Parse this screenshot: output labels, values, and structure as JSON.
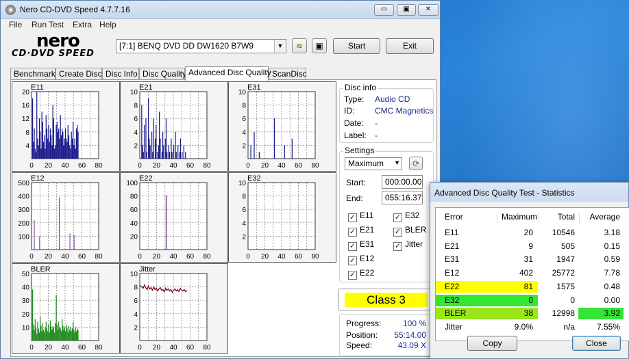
{
  "window": {
    "title": "Nero CD-DVD Speed 4.7.7.16",
    "caption_min": "▭",
    "caption_max": "▣",
    "caption_close": "✕"
  },
  "menu": [
    "File",
    "Run Test",
    "Extra",
    "Help"
  ],
  "logo": {
    "brand": "nero",
    "product": "CD·DVD SPEED"
  },
  "toolbar": {
    "drive": "[7:1]   BENQ DVD DD DW1620 B7W9",
    "start_label": "Start",
    "exit_label": "Exit"
  },
  "tabs": [
    "Benchmark",
    "Create Disc",
    "Disc Info",
    "Disc Quality",
    "Advanced Disc Quality",
    "ScanDisc"
  ],
  "active_tab": "Advanced Disc Quality",
  "charts": [
    {
      "name": "E11",
      "ymax": 20,
      "ticks": [
        "20",
        "16",
        "12",
        "8",
        "4"
      ],
      "color": "#1a1a8c",
      "mode": "bars",
      "values": [
        18,
        5,
        9,
        3,
        2,
        20,
        6,
        4,
        12,
        8,
        3,
        14,
        11,
        5,
        7,
        3,
        13,
        9,
        6,
        10,
        5,
        9,
        7,
        4,
        16,
        12,
        3,
        4,
        10,
        11,
        8,
        9,
        6,
        13,
        7,
        9,
        8,
        4,
        6,
        9,
        6,
        5,
        10,
        7,
        4,
        3,
        8,
        6,
        11,
        4,
        6,
        3,
        9,
        10,
        8
      ]
    },
    {
      "name": "E21",
      "ymax": 10,
      "ticks": [
        "10",
        "8",
        "6",
        "4",
        "2"
      ],
      "color": "#1a1a8c",
      "mode": "bars",
      "values": [
        0,
        8,
        2,
        1,
        5,
        0,
        6,
        1,
        0,
        9,
        3,
        2,
        0,
        4,
        1,
        6,
        0,
        3,
        5,
        0,
        1,
        2,
        7,
        3,
        0,
        1,
        4,
        2,
        0,
        3,
        6,
        1,
        0,
        2,
        1,
        0,
        3,
        1,
        0,
        2,
        0,
        4,
        1,
        0,
        2,
        0,
        1,
        3,
        0,
        1,
        0,
        2,
        0,
        1,
        0
      ]
    },
    {
      "name": "E31",
      "ymax": 10,
      "ticks": [
        "10",
        "8",
        "6",
        "4",
        "2"
      ],
      "color": "#1a1a8c",
      "mode": "bars",
      "values": [
        0,
        0,
        2,
        0,
        0,
        0,
        4,
        0,
        0,
        0,
        0,
        0,
        1,
        0,
        0,
        0,
        0,
        0,
        0,
        0,
        0,
        0,
        0,
        0,
        0,
        0,
        0,
        0,
        0,
        0,
        6,
        0,
        0,
        0,
        0,
        0,
        0,
        0,
        0,
        0,
        0,
        0,
        2,
        0,
        0,
        0,
        0,
        0,
        0,
        0,
        0,
        3,
        0,
        0,
        0
      ]
    },
    {
      "name": "E12",
      "ymax": 500,
      "ticks": [
        "500",
        "400",
        "300",
        "200",
        "100"
      ],
      "color": "#5a1a7a",
      "mode": "bars",
      "values": [
        0,
        0,
        0,
        220,
        0,
        0,
        0,
        0,
        0,
        0,
        0,
        0,
        100,
        0,
        0,
        0,
        0,
        0,
        0,
        0,
        0,
        0,
        0,
        0,
        0,
        0,
        0,
        0,
        0,
        0,
        0,
        0,
        0,
        0,
        0,
        0,
        0,
        0,
        0,
        0,
        0,
        0,
        0,
        0,
        0,
        390,
        0,
        0,
        0,
        0,
        0,
        0,
        0,
        0,
        0,
        0,
        0,
        0,
        0,
        0,
        0,
        0,
        0,
        120,
        0,
        0,
        0,
        0,
        0,
        0,
        110,
        0,
        0,
        0,
        0,
        0,
        0,
        0
      ]
    },
    {
      "name": "E22",
      "ymax": 100,
      "ticks": [
        "100",
        "80",
        "60",
        "40",
        "20"
      ],
      "color": "#5a1a7a",
      "mode": "bars",
      "values": [
        0,
        0,
        0,
        0,
        0,
        0,
        0,
        0,
        0,
        0,
        0,
        0,
        0,
        0,
        0,
        0,
        0,
        0,
        0,
        0,
        0,
        0,
        0,
        0,
        0,
        0,
        0,
        0,
        0,
        0,
        81,
        0,
        0,
        0,
        0,
        0,
        0,
        0,
        0,
        0,
        0,
        0,
        0,
        0,
        0,
        0,
        0,
        0,
        0,
        0,
        0,
        0,
        0,
        0,
        0
      ]
    },
    {
      "name": "E32",
      "ymax": 10,
      "ticks": [
        "10",
        "8",
        "6",
        "4",
        "2"
      ],
      "color": "#5a1a7a",
      "mode": "bars",
      "values": []
    },
    {
      "name": "BLER",
      "ymax": 50,
      "ticks": [
        "50",
        "40",
        "30",
        "20",
        "10"
      ],
      "color": "#1f8a1f",
      "mode": "bars",
      "values": [
        38,
        12,
        8,
        16,
        10,
        5,
        14,
        9,
        6,
        18,
        11,
        7,
        13,
        8,
        6,
        10,
        14,
        9,
        7,
        12,
        6,
        15,
        10,
        8,
        11,
        9,
        6,
        13,
        34,
        12,
        8,
        14,
        10,
        9,
        7,
        16,
        11,
        8,
        10,
        7,
        12,
        9,
        6,
        11,
        8,
        10,
        7,
        9,
        14,
        8,
        6,
        10,
        7,
        9,
        8
      ]
    },
    {
      "name": "Jitter",
      "ymax": 10,
      "ticks": [
        "10",
        "8",
        "6",
        "4",
        "2"
      ],
      "color": "#7a0a1a",
      "mode": "line",
      "values": [
        8.2,
        8.0,
        7.8,
        8.3,
        7.9,
        7.6,
        8.1,
        7.7,
        7.9,
        7.5,
        8.0,
        7.6,
        7.8,
        7.4,
        7.7,
        7.9,
        7.5,
        7.6,
        7.3,
        7.8,
        7.5,
        7.7,
        7.4,
        7.6,
        7.2,
        7.5,
        7.7,
        7.4,
        7.6,
        7.3,
        7.8,
        7.5,
        7.4,
        7.6,
        7.3,
        7.5
      ]
    }
  ],
  "x_ticks": [
    "0",
    "20",
    "40",
    "60",
    "80"
  ],
  "x_max": 80,
  "disc_info": {
    "title": "Disc info",
    "rows": [
      {
        "key": "Type:",
        "value": "Audio CD"
      },
      {
        "key": "ID:",
        "value": "CMC Magnetics"
      },
      {
        "key": "Date:",
        "value": "-"
      },
      {
        "key": "Label:",
        "value": "-"
      }
    ]
  },
  "settings": {
    "title": "Settings",
    "mode": "Maximum",
    "start_label": "Start:",
    "start_value": "000:00.00",
    "end_label": "End:",
    "end_value": "055:16.37",
    "checks_left": [
      "E11",
      "E21",
      "E31",
      "E12",
      "E22"
    ],
    "checks_right": [
      "E32",
      "BLER",
      "Jitter"
    ],
    "check_mark": "✓"
  },
  "class_label": "Class 3",
  "progress": {
    "rows": [
      {
        "key": "Progress:",
        "value": "100 %"
      },
      {
        "key": "Position:",
        "value": "55:14.00"
      },
      {
        "key": "Speed:",
        "value": "43.09 X"
      }
    ]
  },
  "stats_dialog": {
    "title": "Advanced Disc Quality Test - Statistics",
    "headers": [
      "Error",
      "Maximum",
      "Total",
      "Average"
    ],
    "rows": [
      {
        "error": "E11",
        "maximum": "20",
        "total": "10546",
        "average": "3.18",
        "hl": "",
        "hl_avg": ""
      },
      {
        "error": "E21",
        "maximum": "9",
        "total": "505",
        "average": "0.15",
        "hl": "",
        "hl_avg": ""
      },
      {
        "error": "E31",
        "maximum": "31",
        "total": "1947",
        "average": "0.59",
        "hl": "",
        "hl_avg": ""
      },
      {
        "error": "E12",
        "maximum": "402",
        "total": "25772",
        "average": "7.78",
        "hl": "",
        "hl_avg": ""
      },
      {
        "error": "E22",
        "maximum": "81",
        "total": "1575",
        "average": "0.48",
        "hl": "#ffff00",
        "hl_avg": ""
      },
      {
        "error": "E32",
        "maximum": "0",
        "total": "0",
        "average": "0.00",
        "hl": "#33e633",
        "hl_avg": ""
      },
      {
        "error": "BLER",
        "maximum": "38",
        "total": "12998",
        "average": "3.92",
        "hl": "#99e619",
        "hl_avg": "#33e633"
      },
      {
        "error": "Jitter",
        "maximum": "9.0%",
        "total": "n/a",
        "average": "7.55%",
        "hl": "",
        "hl_avg": ""
      }
    ],
    "copy_label": "Copy",
    "close_label": "Close"
  }
}
